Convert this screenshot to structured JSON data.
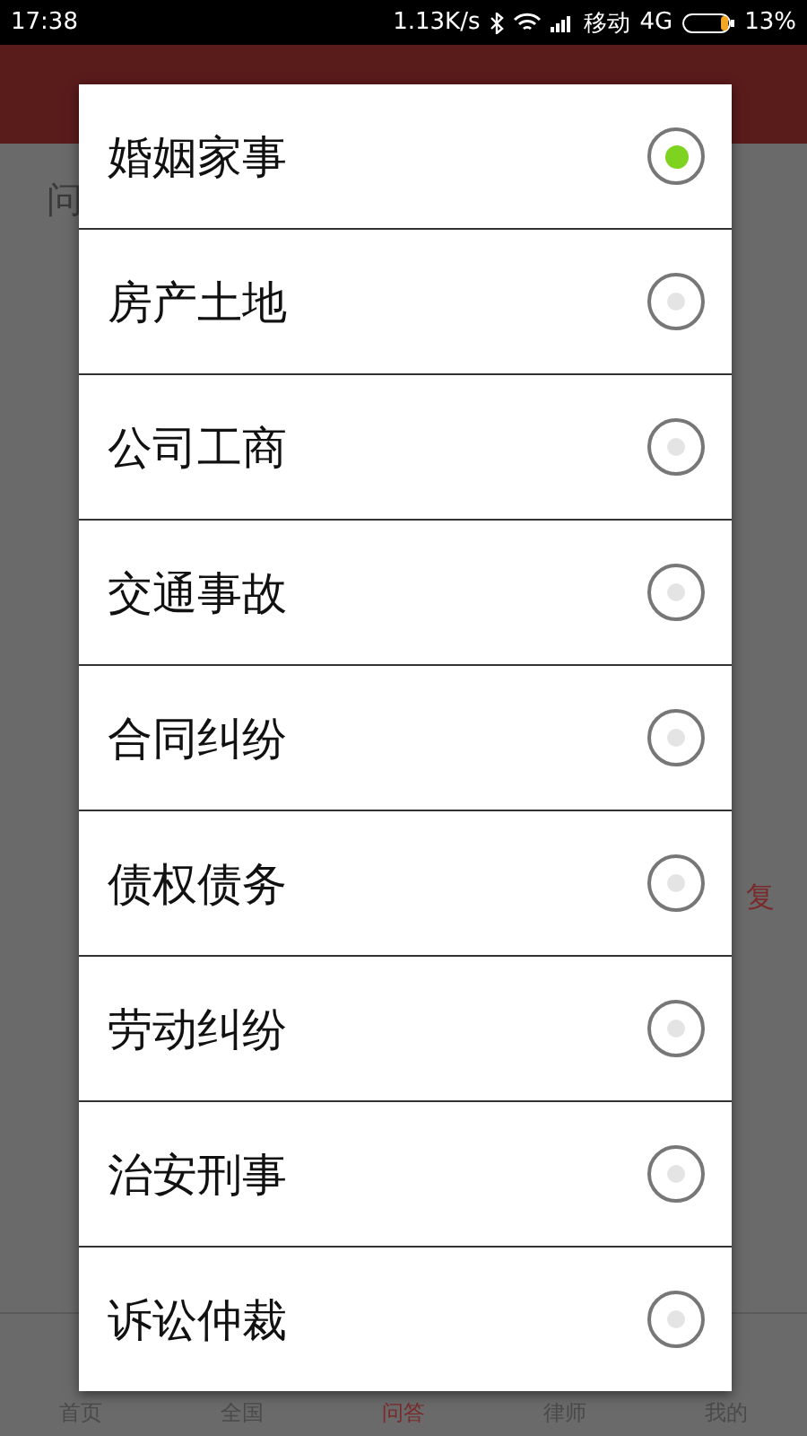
{
  "status_bar": {
    "time": "17:38",
    "speed": "1.13K/s",
    "carrier": "移动",
    "network": "4G",
    "battery": "13%"
  },
  "background": {
    "field_label": "问",
    "reply_link": "复"
  },
  "bottom_nav": [
    {
      "label": "首页",
      "selected": false
    },
    {
      "label": "全国",
      "selected": false
    },
    {
      "label": "问答",
      "selected": true
    },
    {
      "label": "律师",
      "selected": false
    },
    {
      "label": "我的",
      "selected": false
    }
  ],
  "dialog": {
    "options": [
      {
        "label": "婚姻家事",
        "selected": true
      },
      {
        "label": "房产土地",
        "selected": false
      },
      {
        "label": "公司工商",
        "selected": false
      },
      {
        "label": "交通事故",
        "selected": false
      },
      {
        "label": "合同纠纷",
        "selected": false
      },
      {
        "label": "债权债务",
        "selected": false
      },
      {
        "label": "劳动纠纷",
        "selected": false
      },
      {
        "label": "治安刑事",
        "selected": false
      },
      {
        "label": "诉讼仲裁",
        "selected": false
      }
    ]
  }
}
